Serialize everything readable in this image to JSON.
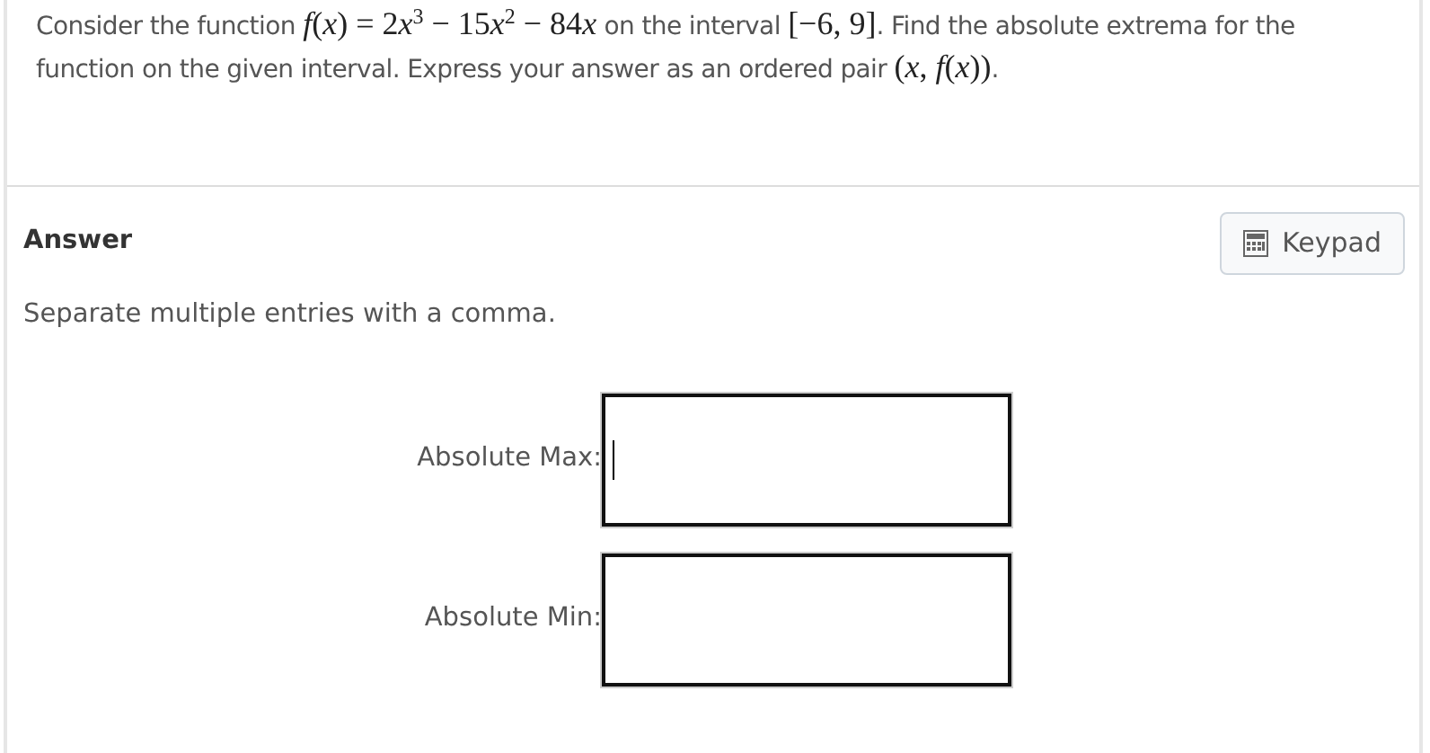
{
  "question": {
    "segments": [
      {
        "kind": "text",
        "text": "Consider the function "
      },
      {
        "kind": "math",
        "parts": [
          {
            "kind": "var",
            "text": "f"
          },
          {
            "kind": "sym",
            "text": "("
          },
          {
            "kind": "var",
            "text": "x"
          },
          {
            "kind": "sym",
            "text": ") = 2"
          },
          {
            "kind": "var",
            "text": "x"
          },
          {
            "kind": "sup",
            "text": "3"
          },
          {
            "kind": "sym",
            "text": " − 15"
          },
          {
            "kind": "var",
            "text": "x"
          },
          {
            "kind": "sup",
            "text": "2"
          },
          {
            "kind": "sym",
            "text": " − 84"
          },
          {
            "kind": "var",
            "text": "x"
          }
        ]
      },
      {
        "kind": "text",
        "text": " on the interval "
      },
      {
        "kind": "math",
        "parts": [
          {
            "kind": "sym",
            "text": "[−6, 9]"
          }
        ]
      },
      {
        "kind": "text",
        "text": ". Find the absolute extrema for the function on the given interval. Express your answer as an ordered pair "
      },
      {
        "kind": "math",
        "parts": [
          {
            "kind": "sym",
            "text": "("
          },
          {
            "kind": "var",
            "text": "x"
          },
          {
            "kind": "sym",
            "text": ", "
          },
          {
            "kind": "var",
            "text": "f"
          },
          {
            "kind": "sym",
            "text": "("
          },
          {
            "kind": "var",
            "text": "x"
          },
          {
            "kind": "sym",
            "text": "))"
          }
        ]
      },
      {
        "kind": "text",
        "text": "."
      }
    ]
  },
  "answer": {
    "heading": "Answer",
    "keypad_button": "Keypad",
    "instructions": "Separate multiple entries with a comma.",
    "fields": [
      {
        "label": "Absolute Max:",
        "focused": true
      },
      {
        "label": "Absolute Min:",
        "focused": false
      }
    ]
  }
}
